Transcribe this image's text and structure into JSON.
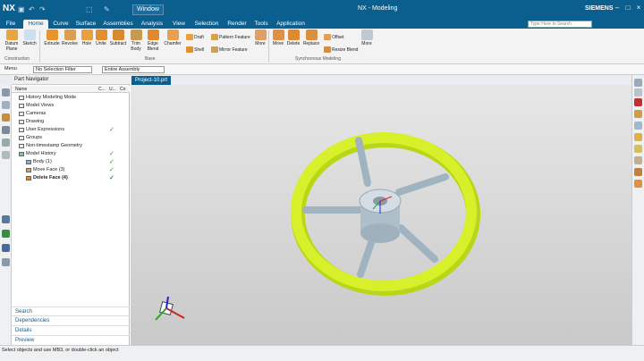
{
  "titlebar": {
    "logo": "NX",
    "window_menu": "Window",
    "app_title": "NX - Modeling",
    "brand": "SIEMENS"
  },
  "tabs": [
    "File",
    "Home",
    "Curve",
    "Surface",
    "Assemblies",
    "Analysis",
    "View",
    "Selection",
    "Render",
    "Tools",
    "Application"
  ],
  "search_placeholder": "Type Here to Search",
  "ribbon": {
    "construction": {
      "datum": "Datum Plane",
      "sketch": "Sketch",
      "group": "Construction"
    },
    "base": {
      "extrude": "Extrude",
      "revolve": "Revolve",
      "hole": "Hole",
      "unite": "Unite",
      "subtract": "Subtract",
      "trim": "Trim Body",
      "edge": "Edge Blend",
      "chamfer": "Chamfer",
      "draft": "Draft",
      "shell": "Shell",
      "pattern": "Pattern Feature",
      "mirror": "Mirror Feature",
      "more": "More",
      "group": "Base"
    },
    "sync": {
      "move": "Move",
      "delete": "Delete",
      "replace": "Replace",
      "offset": "Offset",
      "resize": "Resize Blend",
      "more": "More",
      "group": "Synchronous Modeling"
    }
  },
  "toolbar2": {
    "menu": "Menu",
    "filter": "No Selection Filter",
    "assembly": "Entire Assembly"
  },
  "doc_tab": "Project-10.prt",
  "navigator": {
    "title": "Part Navigator",
    "columns": {
      "name": "Name",
      "c": "C...",
      "u": "U...",
      "co": "Co"
    },
    "rows": [
      {
        "label": "History Modeling Mode",
        "check": ""
      },
      {
        "label": "Model Views",
        "check": ""
      },
      {
        "label": "Cameras",
        "check": ""
      },
      {
        "label": "Drawing",
        "check": ""
      },
      {
        "label": "User Expressions",
        "check": "✓"
      },
      {
        "label": "Groups",
        "check": ""
      },
      {
        "label": "Non-timestamp Geometry",
        "check": ""
      },
      {
        "label": "Model History",
        "check": "✓"
      },
      {
        "label": "Body (1)",
        "check": "✓"
      },
      {
        "label": "Move Face (3)",
        "check": "✓"
      },
      {
        "label": "Delete Face (4)",
        "check": "✓"
      }
    ],
    "footer": [
      "Search",
      "Dependencies",
      "Details",
      "Preview"
    ]
  },
  "status": "Select objects and use MB3, or double-click an object",
  "colors": {
    "titlebar": "#0b5f8f",
    "rim": "#c8e81c",
    "spoke": "#9fb3c0"
  }
}
